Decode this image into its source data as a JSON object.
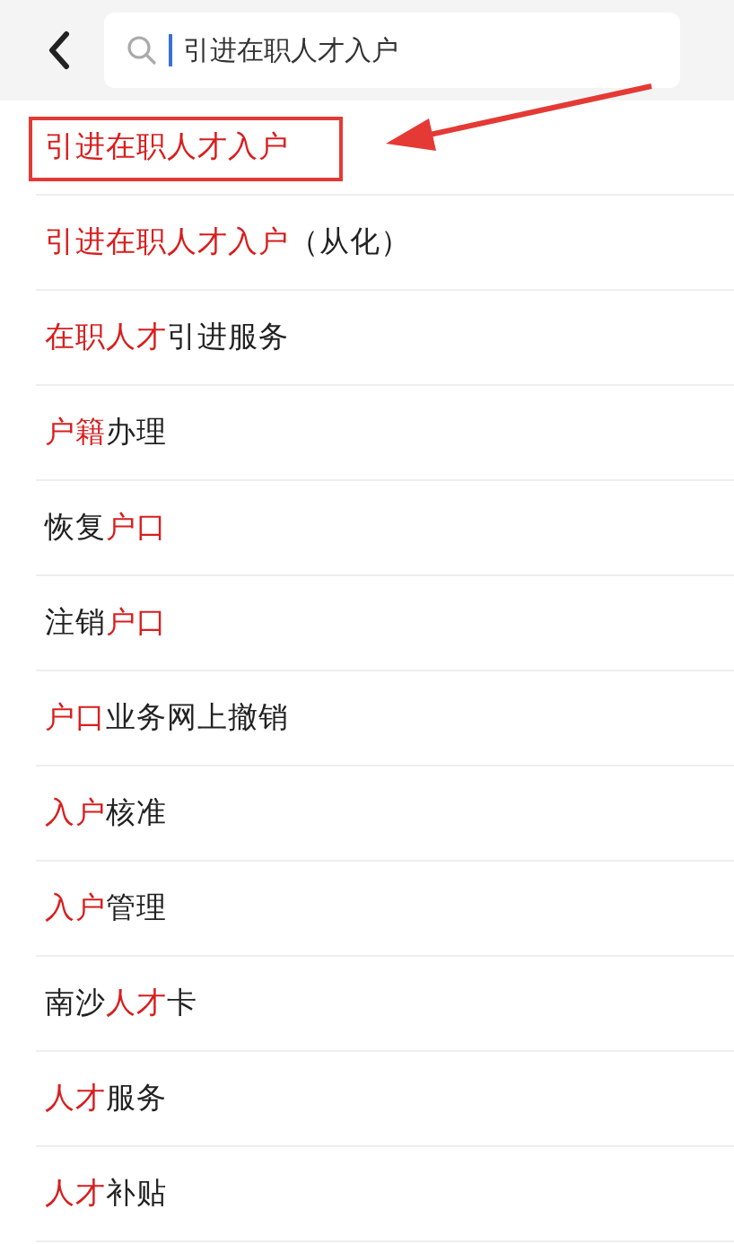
{
  "search": {
    "value": "引进在职人才入户"
  },
  "results": [
    {
      "callout": true,
      "segments": [
        {
          "text": "引进在职人才入户",
          "match": true
        }
      ]
    },
    {
      "callout": false,
      "segments": [
        {
          "text": "引进在职人才入户",
          "match": true
        },
        {
          "text": "（从化）",
          "match": false
        }
      ]
    },
    {
      "callout": false,
      "segments": [
        {
          "text": "在职人才",
          "match": true
        },
        {
          "text": "引进服务",
          "match": false
        }
      ]
    },
    {
      "callout": false,
      "segments": [
        {
          "text": "户籍",
          "match": true
        },
        {
          "text": "办理",
          "match": false
        }
      ]
    },
    {
      "callout": false,
      "segments": [
        {
          "text": "恢复",
          "match": false
        },
        {
          "text": "户口",
          "match": true
        }
      ]
    },
    {
      "callout": false,
      "segments": [
        {
          "text": "注销",
          "match": false
        },
        {
          "text": "户口",
          "match": true
        }
      ]
    },
    {
      "callout": false,
      "segments": [
        {
          "text": "户口",
          "match": true
        },
        {
          "text": "业务网上撤销",
          "match": false
        }
      ]
    },
    {
      "callout": false,
      "segments": [
        {
          "text": "入户",
          "match": true
        },
        {
          "text": "核准",
          "match": false
        }
      ]
    },
    {
      "callout": false,
      "segments": [
        {
          "text": "入户",
          "match": true
        },
        {
          "text": "管理",
          "match": false
        }
      ]
    },
    {
      "callout": false,
      "segments": [
        {
          "text": "南沙",
          "match": false
        },
        {
          "text": "人才",
          "match": true
        },
        {
          "text": "卡",
          "match": false
        }
      ]
    },
    {
      "callout": false,
      "segments": [
        {
          "text": "人才",
          "match": true
        },
        {
          "text": "服务",
          "match": false
        }
      ]
    },
    {
      "callout": false,
      "segments": [
        {
          "text": "人才",
          "match": true
        },
        {
          "text": "补贴",
          "match": false
        }
      ]
    }
  ]
}
